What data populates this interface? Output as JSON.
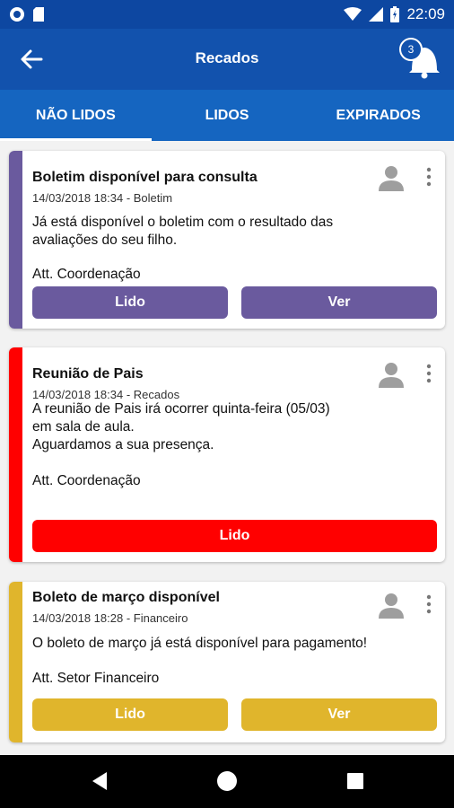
{
  "status_bar": {
    "time": "22:09"
  },
  "app_bar": {
    "title": "Recados",
    "badge_count": "3"
  },
  "tabs": [
    {
      "label": "NÃO LIDOS",
      "active": true
    },
    {
      "label": "LIDOS",
      "active": false
    },
    {
      "label": "EXPIRADOS",
      "active": false
    }
  ],
  "cards": [
    {
      "title": "Boletim disponível para consulta",
      "meta": "14/03/2018 18:34 - Boletim",
      "body": "Já está disponível o boletim com o resultado das\navaliações do seu filho.",
      "sign": "Att. Coordenação",
      "read_label": "Lido",
      "view_label": "Ver",
      "color": "#6a5a9e"
    },
    {
      "title": "Reunião de Pais",
      "meta": "14/03/2018 18:34 - Recados",
      "body": "A reunião de Pais irá ocorrer quinta-feira (05/03)\nem sala de aula.\nAguardamos a sua presença.",
      "sign": "Att. Coordenação",
      "read_label": "Lido",
      "color": "#ff0000"
    },
    {
      "title": "Boleto de março disponível",
      "meta": "14/03/2018 18:28 - Financeiro",
      "body": "O boleto de março já está disponível para pagamento!",
      "sign": "Att. Setor Financeiro",
      "read_label": "Lido",
      "view_label": "Ver",
      "color": "#e0b52c"
    }
  ],
  "colors": {
    "status_bar": "#0d47a1",
    "app_bar": "#1252ad",
    "tabs": "#1565c0"
  }
}
